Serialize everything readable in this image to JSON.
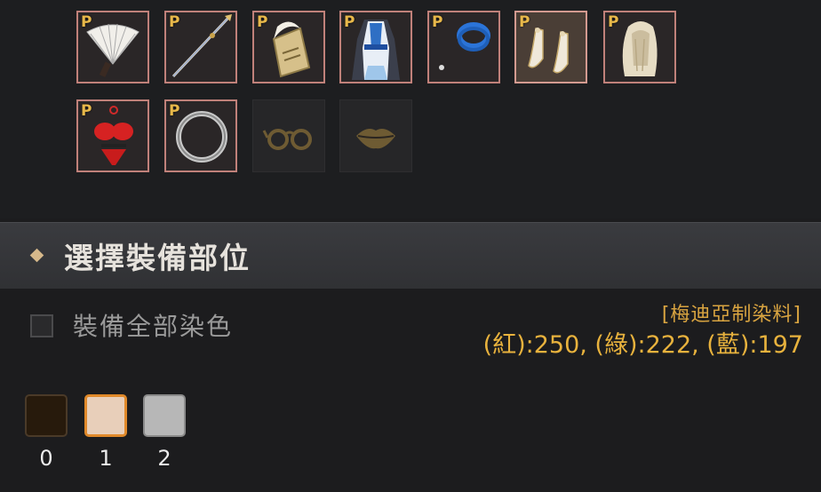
{
  "equipment": {
    "badge": "P",
    "slots": [
      {
        "item": "fan"
      },
      {
        "item": "spear"
      },
      {
        "item": "scroll"
      },
      {
        "item": "robe"
      },
      {
        "item": "bracelet"
      },
      {
        "item": "shoes",
        "selected": true
      },
      {
        "item": "hair"
      },
      {
        "item": "underwear"
      },
      {
        "item": "ring"
      },
      {
        "item": "glasses",
        "empty": true
      },
      {
        "item": "lips",
        "empty": true
      }
    ]
  },
  "section": {
    "title": "選擇裝備部位"
  },
  "dye_all": {
    "label": "裝備全部染色",
    "checked": false
  },
  "dye": {
    "name": "[梅迪亞制染料]",
    "values": "(紅):250, (綠):222, (藍):197"
  },
  "palette": {
    "selected_index": 1,
    "swatches": [
      {
        "label": "0",
        "color": "#271a0c"
      },
      {
        "label": "1",
        "color": "#e8cfba"
      },
      {
        "label": "2",
        "color": "#b7b7b7"
      }
    ]
  },
  "colors": {
    "accent_gold": "#e8b23d",
    "slot_border": "#c0817a",
    "selected_swatch_border": "#e0892a"
  }
}
